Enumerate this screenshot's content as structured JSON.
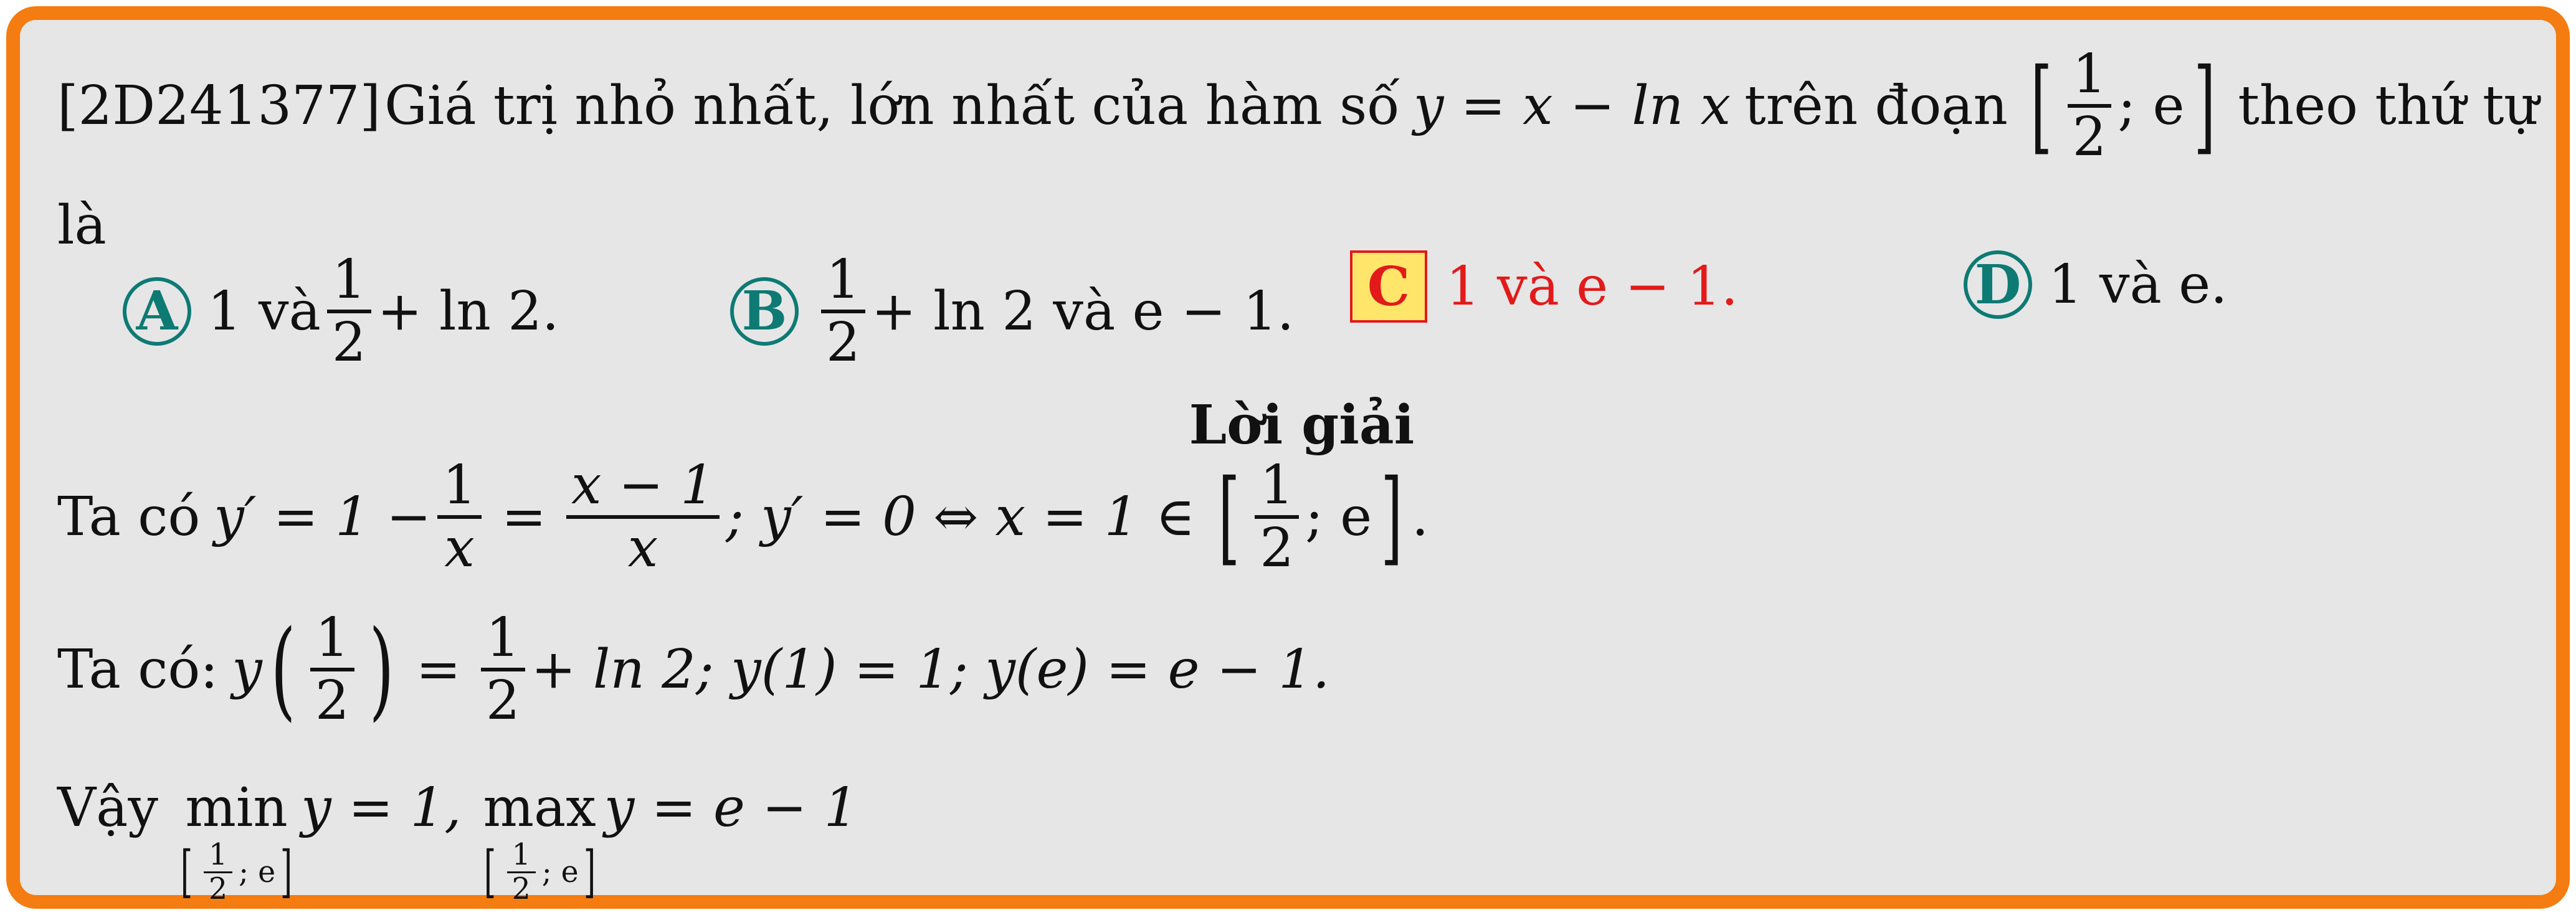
{
  "question": {
    "code": "[2D241377]",
    "text": "Giá trị nhỏ nhất, lớn nhất của hàm số",
    "function": "y = x − ln x",
    "text2": "trên đoạn",
    "interval_num": "1",
    "interval_den": "2",
    "interval_sep": "; e",
    "text3": "theo thứ tự",
    "text4": "là"
  },
  "options": [
    {
      "letter": "A",
      "pre": "1 và",
      "frac_num": "1",
      "frac_den": "2",
      "post": "+ ln 2."
    },
    {
      "letter": "B",
      "frac_num": "1",
      "frac_den": "2",
      "post": "+ ln 2 và e − 1."
    },
    {
      "letter": "C",
      "text": "1 và e − 1.",
      "correct": true
    },
    {
      "letter": "D",
      "text": "1 và e."
    }
  ],
  "solution": {
    "heading": "Lời giải",
    "l1_prefix": "Ta có",
    "l1_a": "y′ = 1 −",
    "l1_f1_num": "1",
    "l1_f1_den": "x",
    "l1_eq": "=",
    "l1_f2_num": "x − 1",
    "l1_f2_den": "x",
    "l1_b": "; y′ = 0 ⇔ x = 1 ∈",
    "l1_i_num": "1",
    "l1_i_den": "2",
    "l1_i_sep": "; e",
    "l1_end": ".",
    "l2_prefix": "Ta có:",
    "l2_y": "y",
    "l2_num": "1",
    "l2_den": "2",
    "l2_eq": "=",
    "l2_num2": "1",
    "l2_den2": "2",
    "l2_rest": "+ ln 2; y(1) = 1; y(e) = e − 1.",
    "l3_prefix": "Vậy",
    "l3_min": "min",
    "l3_max": "max",
    "l3_sub_num": "1",
    "l3_sub_den": "2",
    "l3_sub_sep": "; e",
    "l3_a": "y = 1,",
    "l3_b": "y = e − 1"
  }
}
